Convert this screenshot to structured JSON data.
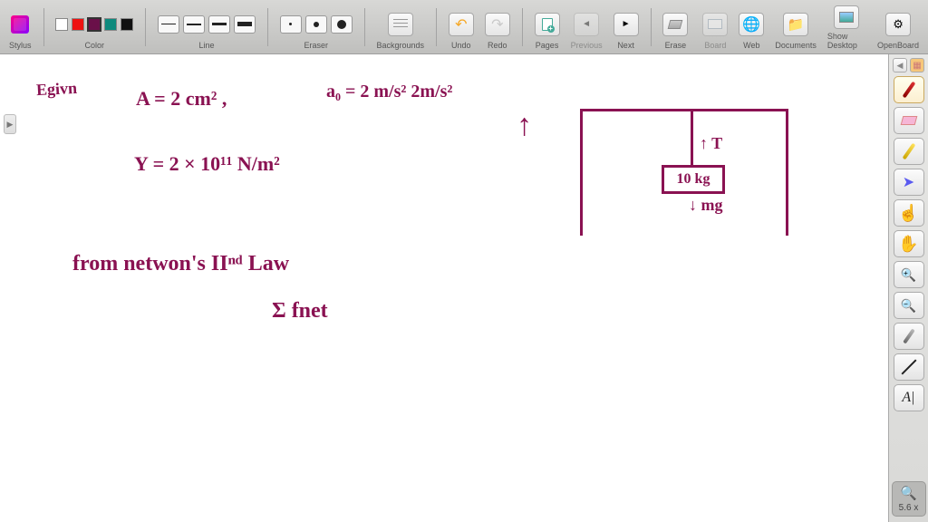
{
  "toolbar": {
    "stylus_label": "Stylus",
    "color_label": "Color",
    "line_label": "Line",
    "eraser_label": "Eraser",
    "backgrounds_label": "Backgrounds",
    "undo_label": "Undo",
    "redo_label": "Redo",
    "pages_label": "Pages",
    "previous_label": "Previous",
    "next_label": "Next",
    "erase_label": "Erase",
    "board_label": "Board",
    "web_label": "Web",
    "documents_label": "Documents",
    "showdesktop_label": "Show Desktop",
    "openboard_label": "OpenBoard",
    "colors": [
      "#ffffff",
      "#e11",
      "#420e4c",
      "#0a8a7a",
      "#111"
    ],
    "selected_color_index": 2
  },
  "side": {
    "zoom_value": "5.6 x"
  },
  "ink": {
    "note_left": "Egivn",
    "eq_area": "A  =  2 cm²   ,",
    "eq_a0": "a₀ = 2 m/s²  2m/s²",
    "eq_gamma": "Y =   2 × 10¹¹  N/m²",
    "law_line": "from  netwon's  IIⁿᵈ  Law",
    "sum_line": "Σ  fnet",
    "diag_T": "↑ T",
    "diag_mass": "10 kg",
    "diag_mg": "↓  mg",
    "big_arrow": "↑"
  }
}
